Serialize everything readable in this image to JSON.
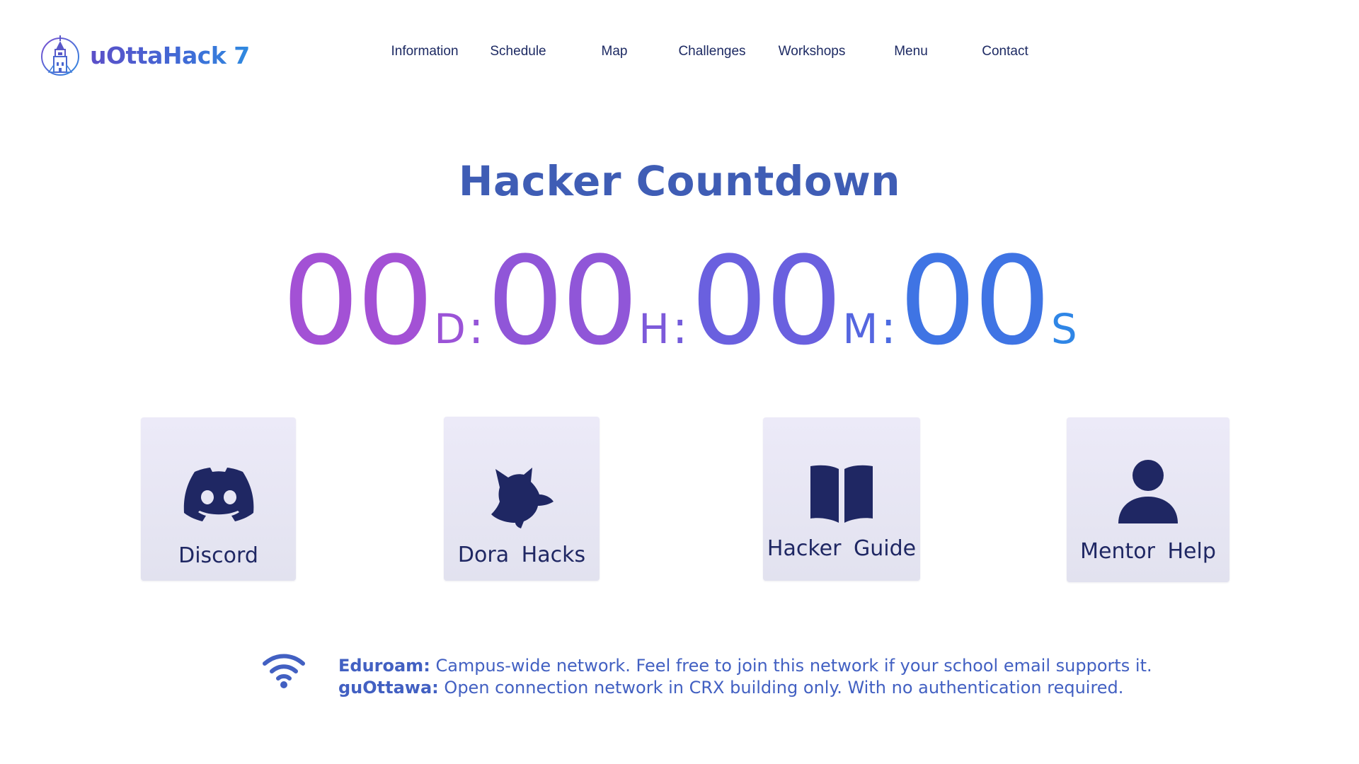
{
  "header": {
    "logo_text": "uOttaHack 7",
    "nav": [
      {
        "label": "Information"
      },
      {
        "label": "Schedule"
      },
      {
        "label": "Map"
      },
      {
        "label": "Challenges"
      },
      {
        "label": "Workshops"
      },
      {
        "label": "Menu"
      },
      {
        "label": "Contact"
      }
    ]
  },
  "countdown": {
    "title": "Hacker Countdown",
    "days": "00",
    "days_unit": "D",
    "hours": "00",
    "hours_unit": "H",
    "minutes": "00",
    "minutes_unit": "M",
    "seconds": "00",
    "seconds_unit": "S",
    "separator": ":"
  },
  "links": [
    {
      "label": "Discord",
      "icon": "discord-icon"
    },
    {
      "label": "Dora Hacks",
      "icon": "dorahacks-icon"
    },
    {
      "label": "Hacker Guide",
      "icon": "book-icon"
    },
    {
      "label": "Mentor Help",
      "icon": "user-icon"
    }
  ],
  "wifi": {
    "icon": "wifi-icon",
    "eduroam_name": "Eduroam:",
    "eduroam_desc": "Campus-wide network. Feel free to join this network if your school email supports it.",
    "guottawa_name": "guOttawa:",
    "guottawa_desc": "Open connection network in CRX building only. With no authentication required."
  },
  "colors": {
    "navy": "#1f2763",
    "title_blue": "#3f5db5",
    "gradient_start": "#a652d6",
    "gradient_end": "#2f86e6",
    "tile_bg": "#e6e5f3"
  }
}
